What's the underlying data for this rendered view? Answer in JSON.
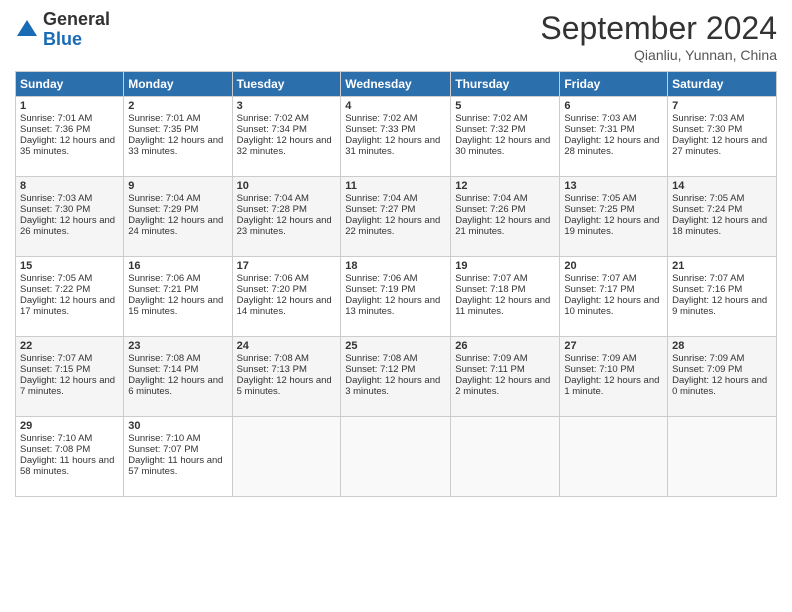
{
  "header": {
    "logo_general": "General",
    "logo_blue": "Blue",
    "month_title": "September 2024",
    "location": "Qianliu, Yunnan, China"
  },
  "calendar": {
    "days_of_week": [
      "Sunday",
      "Monday",
      "Tuesday",
      "Wednesday",
      "Thursday",
      "Friday",
      "Saturday"
    ],
    "weeks": [
      [
        null,
        {
          "day": "2",
          "sunrise": "Sunrise: 7:01 AM",
          "sunset": "Sunset: 7:35 PM",
          "daylight": "Daylight: 12 hours and 33 minutes."
        },
        {
          "day": "3",
          "sunrise": "Sunrise: 7:02 AM",
          "sunset": "Sunset: 7:34 PM",
          "daylight": "Daylight: 12 hours and 32 minutes."
        },
        {
          "day": "4",
          "sunrise": "Sunrise: 7:02 AM",
          "sunset": "Sunset: 7:33 PM",
          "daylight": "Daylight: 12 hours and 31 minutes."
        },
        {
          "day": "5",
          "sunrise": "Sunrise: 7:02 AM",
          "sunset": "Sunset: 7:32 PM",
          "daylight": "Daylight: 12 hours and 30 minutes."
        },
        {
          "day": "6",
          "sunrise": "Sunrise: 7:03 AM",
          "sunset": "Sunset: 7:31 PM",
          "daylight": "Daylight: 12 hours and 28 minutes."
        },
        {
          "day": "7",
          "sunrise": "Sunrise: 7:03 AM",
          "sunset": "Sunset: 7:30 PM",
          "daylight": "Daylight: 12 hours and 27 minutes."
        }
      ],
      [
        {
          "day": "1",
          "sunrise": "Sunrise: 7:01 AM",
          "sunset": "Sunset: 7:36 PM",
          "daylight": "Daylight: 12 hours and 35 minutes."
        },
        {
          "day": "9",
          "sunrise": "Sunrise: 7:04 AM",
          "sunset": "Sunset: 7:29 PM",
          "daylight": "Daylight: 12 hours and 24 minutes."
        },
        {
          "day": "10",
          "sunrise": "Sunrise: 7:04 AM",
          "sunset": "Sunset: 7:28 PM",
          "daylight": "Daylight: 12 hours and 23 minutes."
        },
        {
          "day": "11",
          "sunrise": "Sunrise: 7:04 AM",
          "sunset": "Sunset: 7:27 PM",
          "daylight": "Daylight: 12 hours and 22 minutes."
        },
        {
          "day": "12",
          "sunrise": "Sunrise: 7:04 AM",
          "sunset": "Sunset: 7:26 PM",
          "daylight": "Daylight: 12 hours and 21 minutes."
        },
        {
          "day": "13",
          "sunrise": "Sunrise: 7:05 AM",
          "sunset": "Sunset: 7:25 PM",
          "daylight": "Daylight: 12 hours and 19 minutes."
        },
        {
          "day": "14",
          "sunrise": "Sunrise: 7:05 AM",
          "sunset": "Sunset: 7:24 PM",
          "daylight": "Daylight: 12 hours and 18 minutes."
        }
      ],
      [
        {
          "day": "8",
          "sunrise": "Sunrise: 7:03 AM",
          "sunset": "Sunset: 7:30 PM",
          "daylight": "Daylight: 12 hours and 26 minutes."
        },
        {
          "day": "16",
          "sunrise": "Sunrise: 7:06 AM",
          "sunset": "Sunset: 7:21 PM",
          "daylight": "Daylight: 12 hours and 15 minutes."
        },
        {
          "day": "17",
          "sunrise": "Sunrise: 7:06 AM",
          "sunset": "Sunset: 7:20 PM",
          "daylight": "Daylight: 12 hours and 14 minutes."
        },
        {
          "day": "18",
          "sunrise": "Sunrise: 7:06 AM",
          "sunset": "Sunset: 7:19 PM",
          "daylight": "Daylight: 12 hours and 13 minutes."
        },
        {
          "day": "19",
          "sunrise": "Sunrise: 7:07 AM",
          "sunset": "Sunset: 7:18 PM",
          "daylight": "Daylight: 12 hours and 11 minutes."
        },
        {
          "day": "20",
          "sunrise": "Sunrise: 7:07 AM",
          "sunset": "Sunset: 7:17 PM",
          "daylight": "Daylight: 12 hours and 10 minutes."
        },
        {
          "day": "21",
          "sunrise": "Sunrise: 7:07 AM",
          "sunset": "Sunset: 7:16 PM",
          "daylight": "Daylight: 12 hours and 9 minutes."
        }
      ],
      [
        {
          "day": "15",
          "sunrise": "Sunrise: 7:05 AM",
          "sunset": "Sunset: 7:22 PM",
          "daylight": "Daylight: 12 hours and 17 minutes."
        },
        {
          "day": "23",
          "sunrise": "Sunrise: 7:08 AM",
          "sunset": "Sunset: 7:14 PM",
          "daylight": "Daylight: 12 hours and 6 minutes."
        },
        {
          "day": "24",
          "sunrise": "Sunrise: 7:08 AM",
          "sunset": "Sunset: 7:13 PM",
          "daylight": "Daylight: 12 hours and 5 minutes."
        },
        {
          "day": "25",
          "sunrise": "Sunrise: 7:08 AM",
          "sunset": "Sunset: 7:12 PM",
          "daylight": "Daylight: 12 hours and 3 minutes."
        },
        {
          "day": "26",
          "sunrise": "Sunrise: 7:09 AM",
          "sunset": "Sunset: 7:11 PM",
          "daylight": "Daylight: 12 hours and 2 minutes."
        },
        {
          "day": "27",
          "sunrise": "Sunrise: 7:09 AM",
          "sunset": "Sunset: 7:10 PM",
          "daylight": "Daylight: 12 hours and 1 minute."
        },
        {
          "day": "28",
          "sunrise": "Sunrise: 7:09 AM",
          "sunset": "Sunset: 7:09 PM",
          "daylight": "Daylight: 12 hours and 0 minutes."
        }
      ],
      [
        {
          "day": "22",
          "sunrise": "Sunrise: 7:07 AM",
          "sunset": "Sunset: 7:15 PM",
          "daylight": "Daylight: 12 hours and 7 minutes."
        },
        {
          "day": "30",
          "sunrise": "Sunrise: 7:10 AM",
          "sunset": "Sunset: 7:07 PM",
          "daylight": "Daylight: 11 hours and 57 minutes."
        },
        null,
        null,
        null,
        null,
        null
      ],
      [
        {
          "day": "29",
          "sunrise": "Sunrise: 7:10 AM",
          "sunset": "Sunset: 7:08 PM",
          "daylight": "Daylight: 11 hours and 58 minutes."
        },
        null,
        null,
        null,
        null,
        null,
        null
      ]
    ]
  }
}
